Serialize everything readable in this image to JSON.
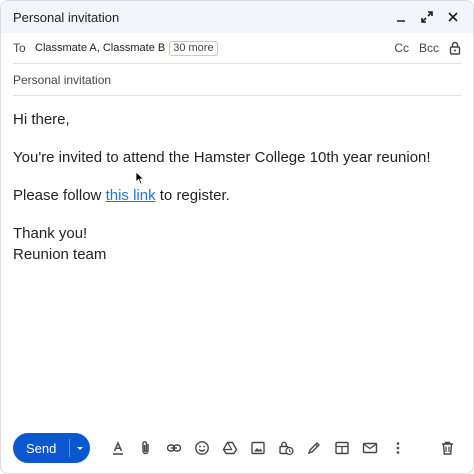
{
  "window": {
    "title": "Personal invitation"
  },
  "header": {
    "to_label": "To",
    "recipients": "Classmate A, Classmate B",
    "more_chip": "30 more",
    "cc_label": "Cc",
    "bcc_label": "Bcc"
  },
  "subject": "Personal invitation",
  "body": {
    "greeting": "Hi there,",
    "line1": "You're invited to attend the Hamster College 10th year reunion!",
    "line2_before": "Please follow ",
    "line2_link": "this link",
    "line2_after": " to register.",
    "closing": "Thank you!",
    "signature": "Reunion team"
  },
  "toolbar": {
    "send_label": "Send"
  },
  "colors": {
    "accent": "#0b57d0",
    "link": "#1a73e8",
    "titlebar_bg": "#f2f6fc",
    "chip_border": "#f4c95d"
  }
}
